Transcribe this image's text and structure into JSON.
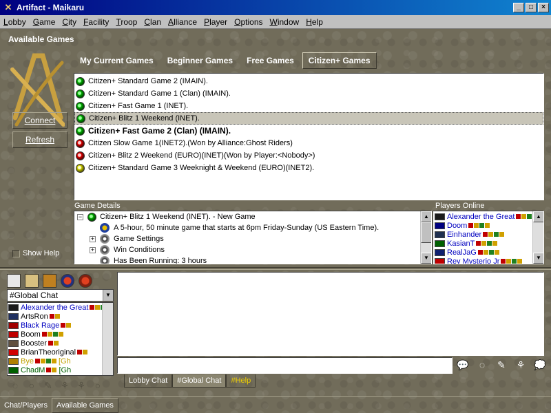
{
  "window": {
    "title": "Artifact - Maikaru",
    "app_icon": "artifact-logo-icon"
  },
  "menu": [
    "Lobby",
    "Game",
    "City",
    "Facility",
    "Troop",
    "Clan",
    "Alliance",
    "Player",
    "Options",
    "Window",
    "Help"
  ],
  "available_games": {
    "title": "Available Games",
    "connect_label": "Connect",
    "refresh_label": "Refresh",
    "show_help_label": "Show Help",
    "tabs": [
      "My Current Games",
      "Beginner Games",
      "Free Games",
      "Citizen+ Games"
    ],
    "active_tab": "Citizen+ Games",
    "games": [
      {
        "label": "Citizen+ Standard Game 2 (IMAIN).",
        "status": "green"
      },
      {
        "label": "Citizen+ Standard Game 1 (Clan) (IMAIN).",
        "status": "green"
      },
      {
        "label": "Citizen+ Fast Game 1 (INET).",
        "status": "green"
      },
      {
        "label": "Citizen+ Blitz 1 Weekend (INET).",
        "status": "green",
        "selected": true
      },
      {
        "label": "Citizen+ Fast Game 2 (Clan) (IMAIN).",
        "status": "green",
        "bold": true
      },
      {
        "label": "Citizen Slow Game 1(INET2).(Won by Alliance:Ghost Riders)",
        "status": "red"
      },
      {
        "label": "Citizen+ Blitz 2 Weekend (EURO)(INET)(Won by Player:<Nobody>)",
        "status": "red"
      },
      {
        "label": "Citizen+ Standard Game 3 Weeknight & Weekend (EURO)(INET2).",
        "status": "yellow"
      }
    ]
  },
  "game_details": {
    "label": "Game Details",
    "root": "Citizen+ Blitz 1 Weekend (INET). - New Game",
    "rows": [
      {
        "text": "A 5-hour, 50 minute game that starts at 6pm Friday-Sunday (US Eastern Time).",
        "expander": false,
        "icon": "globe-icon"
      },
      {
        "text": "Game Settings",
        "expander": true,
        "icon": "gear-icon"
      },
      {
        "text": "Win Conditions",
        "expander": true,
        "icon": "gear-icon"
      },
      {
        "text": "Has Been Running:  3 hours",
        "expander": false,
        "icon": "gear-icon"
      }
    ]
  },
  "players_online": {
    "label": "Players Online",
    "players": [
      {
        "name": "Alexander the Great",
        "flag": "#1a1a1a"
      },
      {
        "name": "Doom",
        "flag": "#000080"
      },
      {
        "name": "Einhander",
        "flag": "#203050"
      },
      {
        "name": "KasianT",
        "flag": "#006000"
      },
      {
        "name": "RealJaG",
        "flag": "#102070"
      },
      {
        "name": "Rey Mysterio Jr",
        "flag": "#c00000"
      }
    ]
  },
  "chat": {
    "channel": "#Global Chat",
    "users": [
      {
        "name": "Alexander the Great",
        "color": "blue",
        "flag": "#1a1a1a"
      },
      {
        "name": "ArtsRon",
        "color": "black",
        "flag": "#203060"
      },
      {
        "name": "Black Rage",
        "color": "blue",
        "flag": "#a00000"
      },
      {
        "name": "Boom",
        "color": "black",
        "flag": "#c00000"
      },
      {
        "name": "Booster",
        "color": "black",
        "flag": "#605040"
      },
      {
        "name": "BrianTheoriginal",
        "color": "black",
        "flag": "#d00000"
      },
      {
        "name": "Bye",
        "color": "olive",
        "flag": "#b08000",
        "suffix": "[Gh"
      },
      {
        "name": "ChadM",
        "color": "green",
        "flag": "#006000",
        "suffix": "[Gh"
      }
    ],
    "tabs": [
      "Lobby Chat",
      "#Global Chat",
      "#Help"
    ],
    "active_tab": "#Global Chat"
  },
  "bottom_tabs": [
    "Chat/Players",
    "Available Games"
  ],
  "bottom_active": "Available Games"
}
